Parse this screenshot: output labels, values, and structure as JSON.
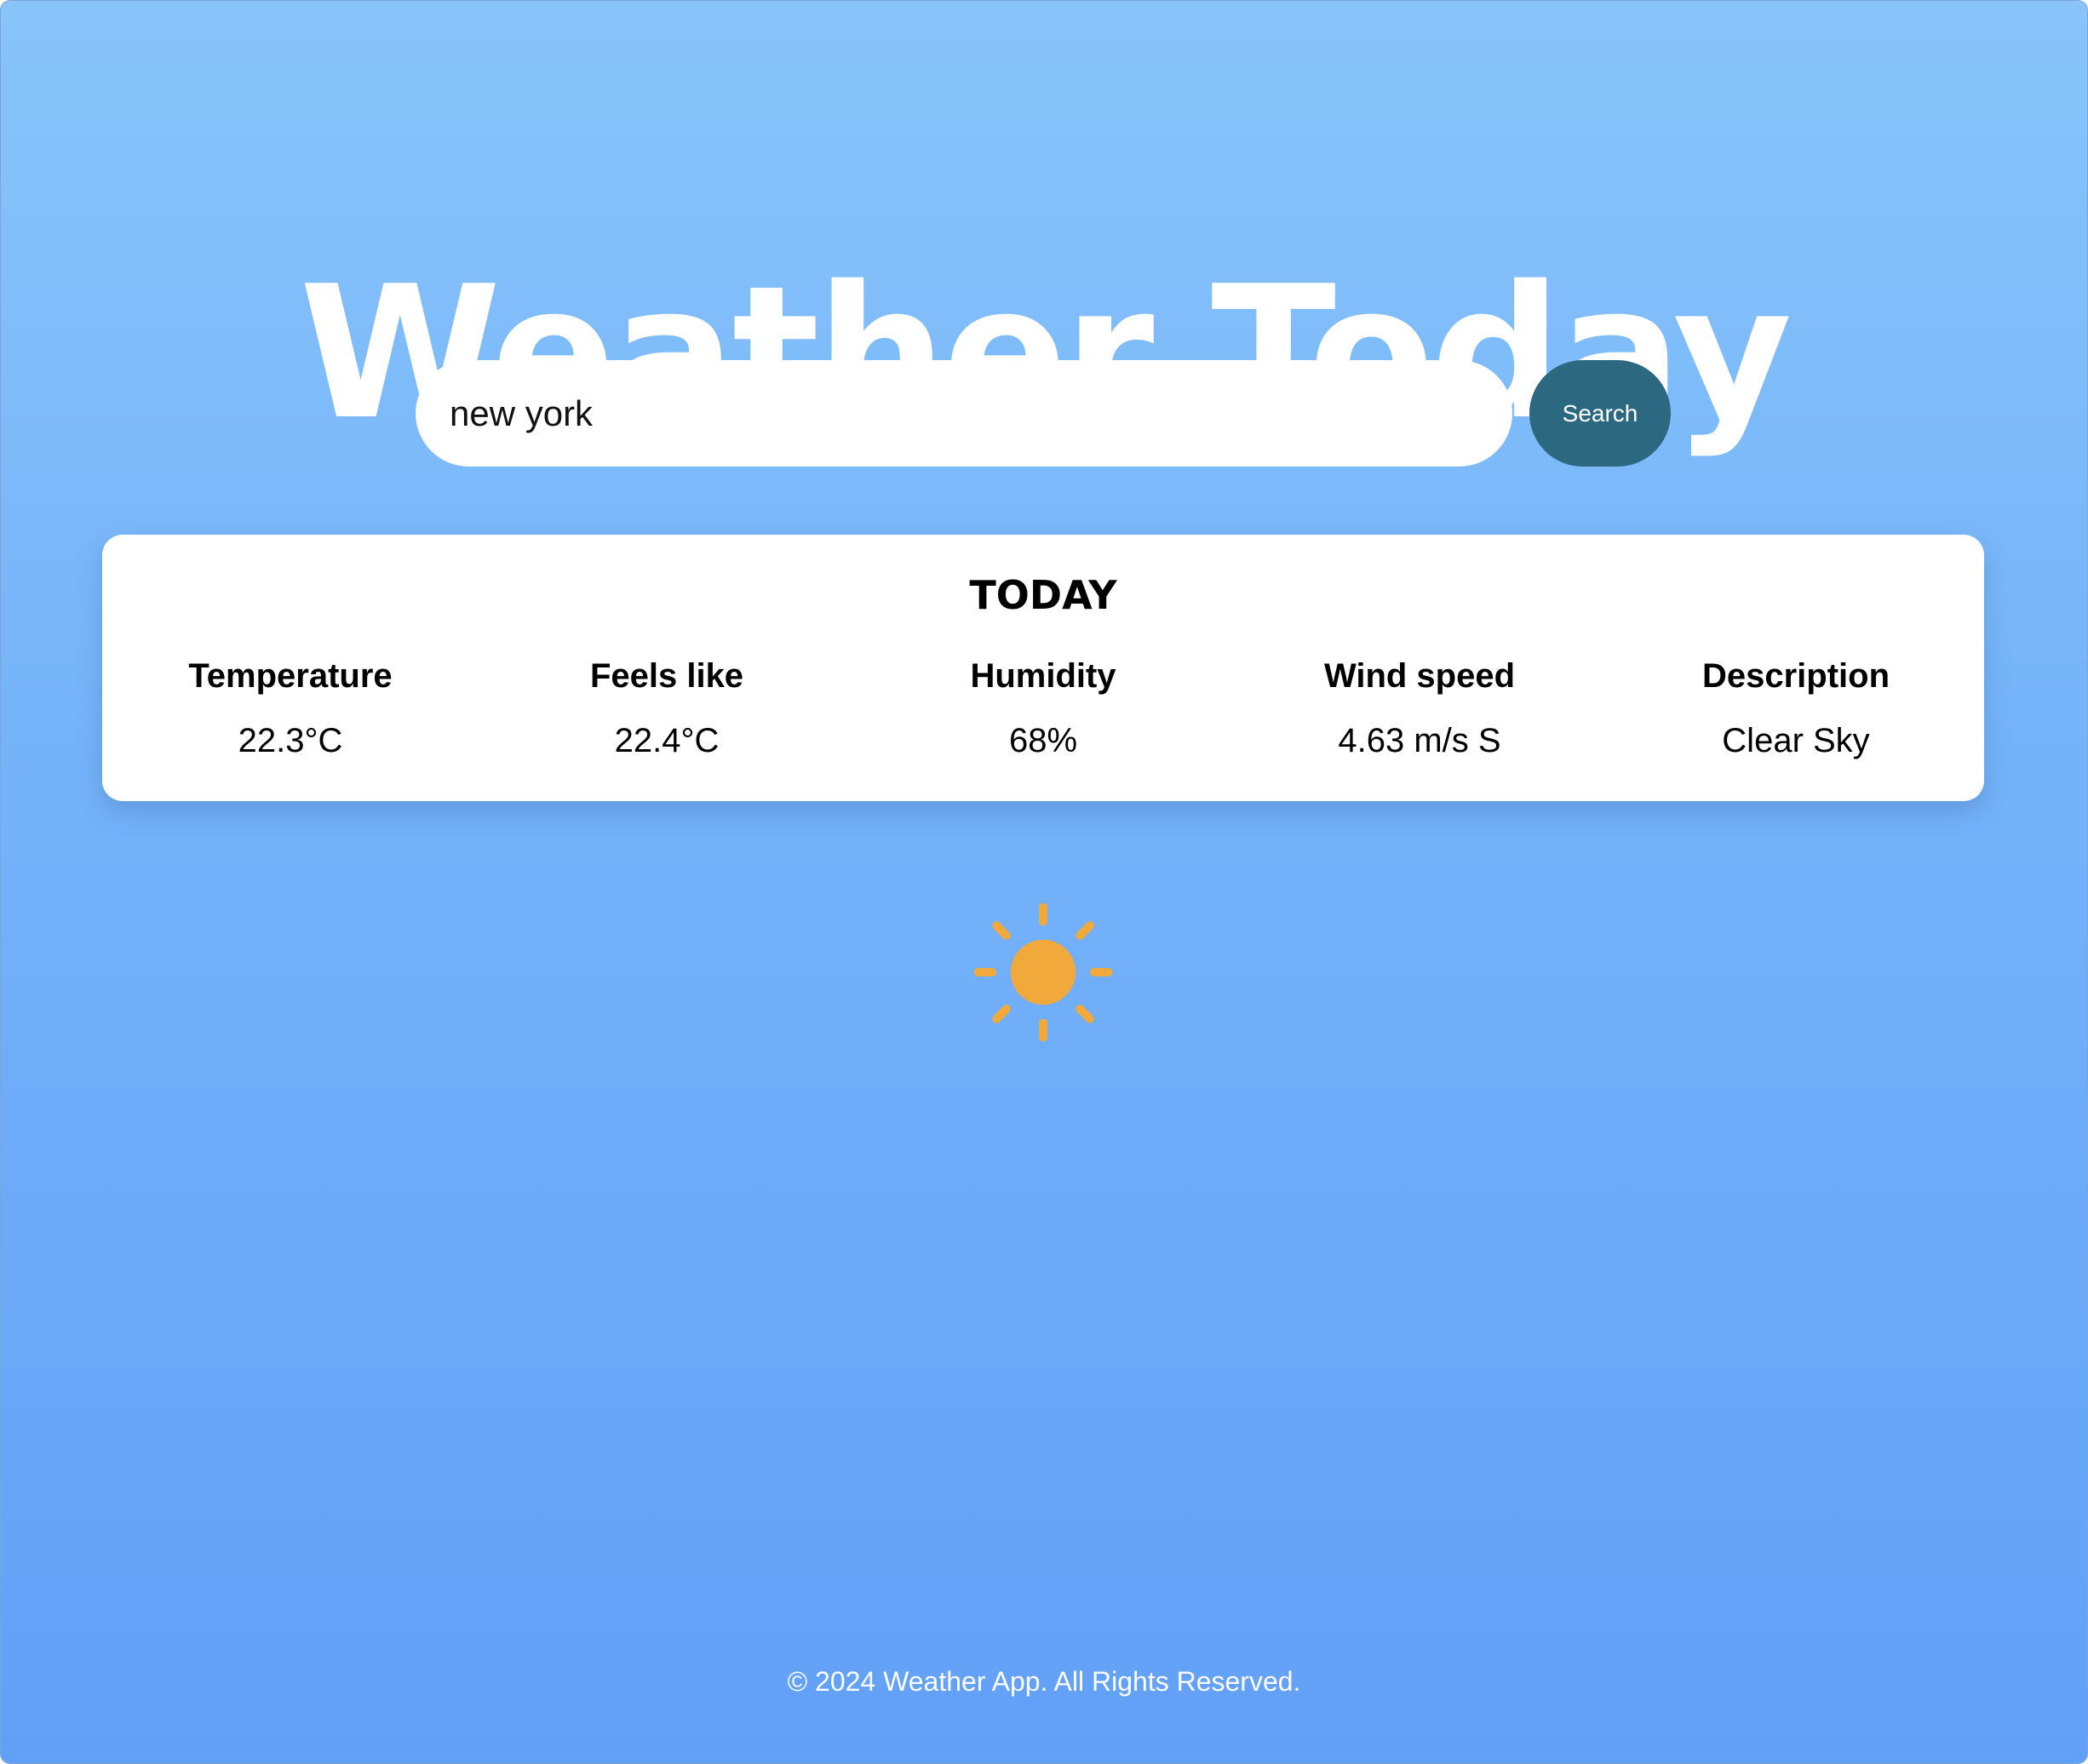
{
  "app": {
    "title": "Weather Today"
  },
  "search": {
    "value": "new york",
    "button_label": "Search"
  },
  "today": {
    "heading": "TODAY",
    "metrics": [
      {
        "label": "Temperature",
        "value": "22.3°C"
      },
      {
        "label": "Feels like",
        "value": "22.4°C"
      },
      {
        "label": "Humidity",
        "value": "68%"
      },
      {
        "label": "Wind speed",
        "value": "4.63 m/s S"
      },
      {
        "label": "Description",
        "value": "Clear Sky"
      }
    ]
  },
  "weather_icon": {
    "name": "sun-icon",
    "color": "#f2a93b"
  },
  "footer": {
    "text": "© 2024 Weather App. All Rights Reserved."
  },
  "colors": {
    "gradient_top": "#88c4fa",
    "gradient_bottom": "#62a0f8",
    "button": "#2c6880"
  }
}
